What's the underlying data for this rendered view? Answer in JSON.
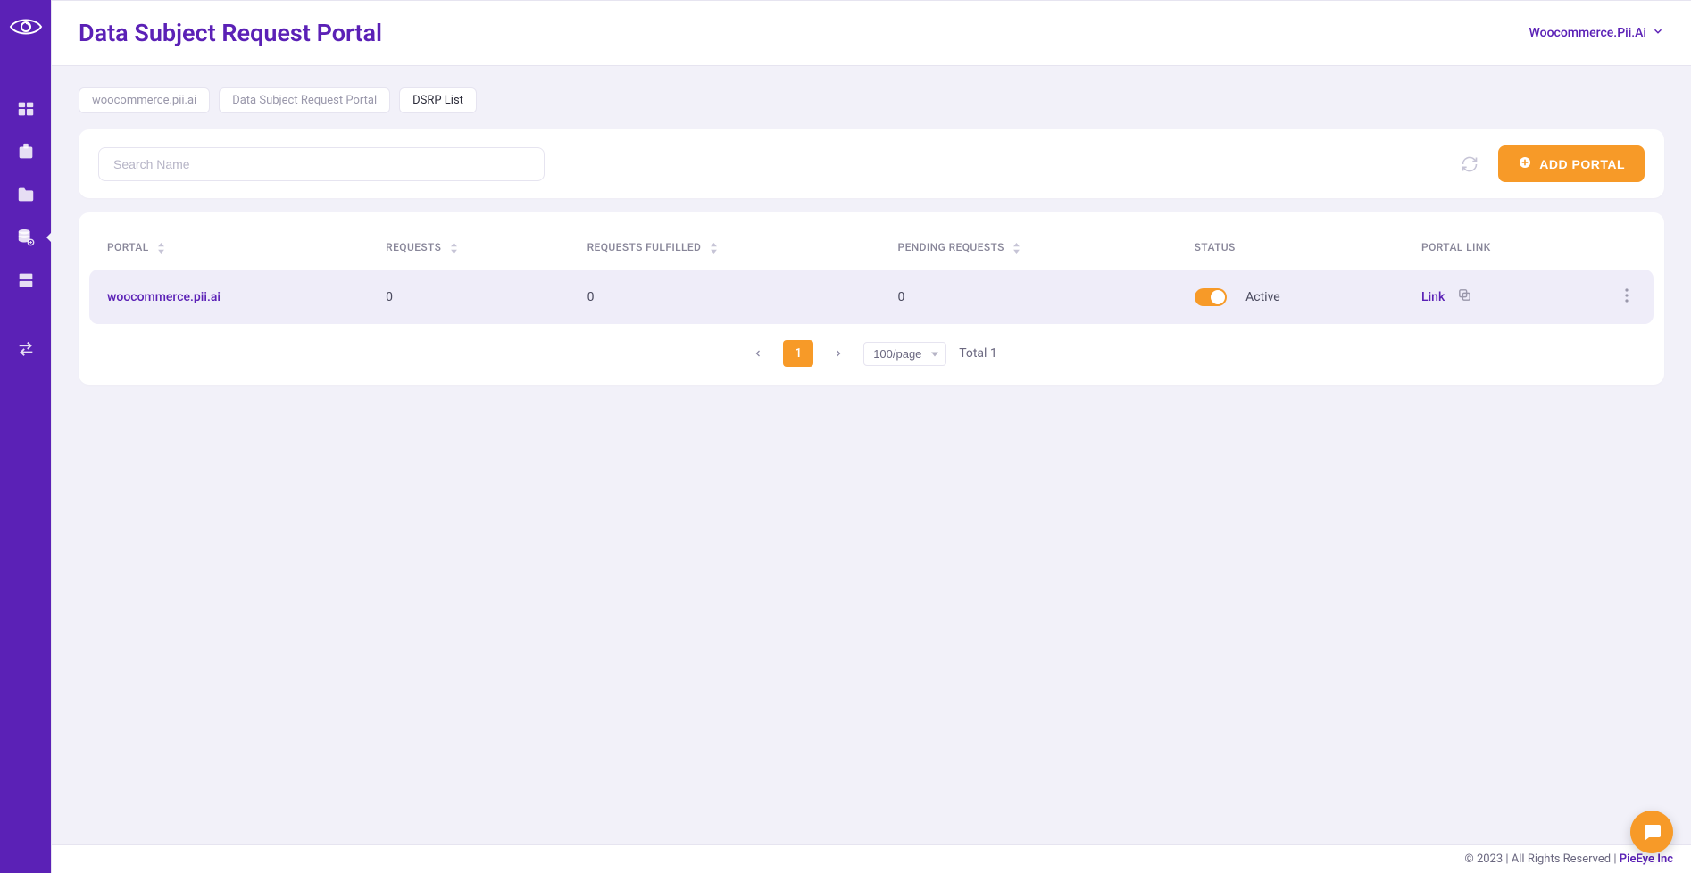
{
  "header": {
    "title": "Data Subject Request Portal",
    "account_label": "Woocommerce.Pii.Ai"
  },
  "sidebar": {
    "items": [
      {
        "name": "dashboard-icon"
      },
      {
        "name": "task-board-icon"
      },
      {
        "name": "folder-icon"
      },
      {
        "name": "database-gear-icon",
        "active": true
      },
      {
        "name": "database-icon"
      },
      {
        "name": "transfer-icon"
      }
    ]
  },
  "breadcrumbs": [
    {
      "label": "woocommerce.pii.ai",
      "current": false
    },
    {
      "label": "Data Subject Request Portal",
      "current": false
    },
    {
      "label": "DSRP List",
      "current": true
    }
  ],
  "toolbar": {
    "search_placeholder": "Search Name",
    "add_button_label": "ADD PORTAL"
  },
  "table": {
    "headers": {
      "portal": "PORTAL",
      "requests": "REQUESTS",
      "fulfilled": "REQUESTS FULFILLED",
      "pending": "PENDING REQUESTS",
      "status": "STATUS",
      "portal_link": "PORTAL LINK"
    },
    "rows": [
      {
        "portal": "woocommerce.pii.ai",
        "requests": "0",
        "fulfilled": "0",
        "pending": "0",
        "status_on": true,
        "status_label": "Active",
        "link_label": "Link"
      }
    ]
  },
  "pagination": {
    "current_page": "1",
    "page_size_label": "100/page",
    "total_label": "Total 1"
  },
  "footer": {
    "text": "© 2023 | All Rights Reserved | ",
    "brand": "PieEye Inc"
  }
}
